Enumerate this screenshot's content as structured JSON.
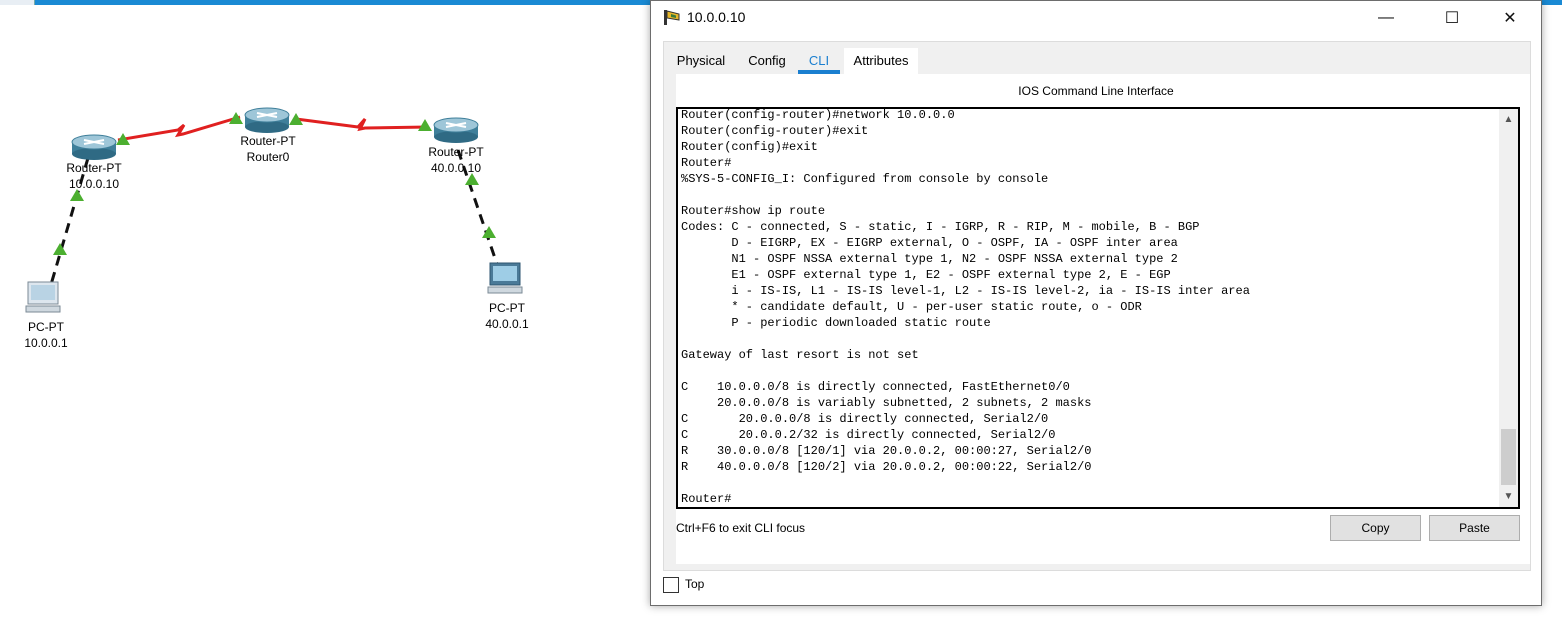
{
  "workspace": {
    "devices": [
      {
        "id": "router-left",
        "type": "Router-PT",
        "name": "10.0.0.10"
      },
      {
        "id": "router-middle",
        "type": "Router-PT",
        "name": "Router0"
      },
      {
        "id": "router-right",
        "type": "Router-PT",
        "name": "40.0.0.10"
      },
      {
        "id": "pc-left",
        "type": "PC-PT",
        "name": "10.0.0.1"
      },
      {
        "id": "pc-right",
        "type": "PC-PT",
        "name": "40.0.0.1"
      }
    ],
    "colors": {
      "serial_link": "#e02020",
      "ethernet_link": "#111111",
      "link_up": "#4caf30",
      "topbar": "#1a8ad4"
    }
  },
  "dialog": {
    "title": "10.0.0.10",
    "controls": {
      "minimize": "—",
      "maximize": "☐",
      "close": "✕"
    },
    "tabs": [
      "Physical",
      "Config",
      "CLI",
      "Attributes"
    ],
    "active_tab": "CLI",
    "cli_heading": "IOS Command Line Interface",
    "terminal_text": "Router(config-router)#network 10.0.0.0\nRouter(config-router)#exit\nRouter(config)#exit\nRouter#\n%SYS-5-CONFIG_I: Configured from console by console\n\nRouter#show ip route\nCodes: C - connected, S - static, I - IGRP, R - RIP, M - mobile, B - BGP\n       D - EIGRP, EX - EIGRP external, O - OSPF, IA - OSPF inter area\n       N1 - OSPF NSSA external type 1, N2 - OSPF NSSA external type 2\n       E1 - OSPF external type 1, E2 - OSPF external type 2, E - EGP\n       i - IS-IS, L1 - IS-IS level-1, L2 - IS-IS level-2, ia - IS-IS inter area\n       * - candidate default, U - per-user static route, o - ODR\n       P - periodic downloaded static route\n\nGateway of last resort is not set\n\nC    10.0.0.0/8 is directly connected, FastEthernet0/0\n     20.0.0.0/8 is variably subnetted, 2 subnets, 2 masks\nC       20.0.0.0/8 is directly connected, Serial2/0\nC       20.0.0.2/32 is directly connected, Serial2/0\nR    30.0.0.0/8 [120/1] via 20.0.0.2, 00:00:27, Serial2/0\nR    40.0.0.0/8 [120/2] via 20.0.0.2, 00:00:22, Serial2/0\n\nRouter#",
    "hint": "Ctrl+F6 to exit CLI focus",
    "copy_label": "Copy",
    "paste_label": "Paste",
    "top_label": "Top",
    "top_checked": false
  }
}
